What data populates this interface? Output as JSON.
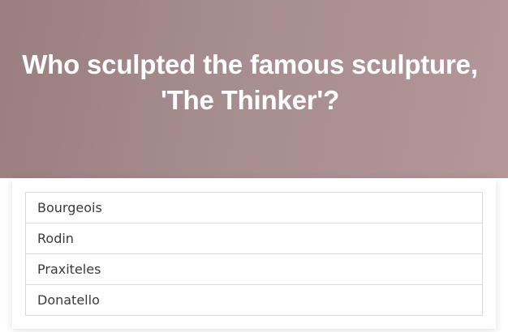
{
  "quiz": {
    "question": "Who sculpted the famous sculpture, 'The Thinker'?",
    "answers": [
      {
        "label": "Bourgeois"
      },
      {
        "label": "Rodin"
      },
      {
        "label": "Praxiteles"
      },
      {
        "label": "Donatello"
      }
    ]
  },
  "colors": {
    "header_gradient_start": "#9a7e80",
    "header_gradient_end": "#b39799",
    "question_text": "#ffffff",
    "answer_text": "#3a3a3a",
    "border": "#d9d9d9"
  }
}
